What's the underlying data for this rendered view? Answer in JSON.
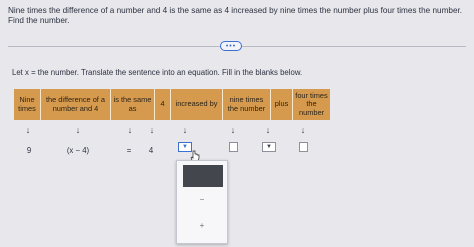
{
  "question": {
    "text": "Nine times the difference of a number and 4 is the same as 4 increased by nine times the number plus four times the number. Find the number."
  },
  "more_button": {
    "label": "•••"
  },
  "instruction": "Let x = the number. Translate the sentence into an equation. Fill in the blanks below.",
  "table": {
    "headers": [
      "Nine times",
      "the difference of a number and 4",
      "is the same as",
      "4",
      "increased by",
      "nine times the number",
      "plus",
      "four times the number"
    ],
    "arrow": "↓",
    "values": [
      "9",
      "(x − 4)",
      "=",
      "4"
    ],
    "dropdown_symbol": "▼"
  },
  "popup": {
    "options": [
      "−",
      "+"
    ]
  }
}
